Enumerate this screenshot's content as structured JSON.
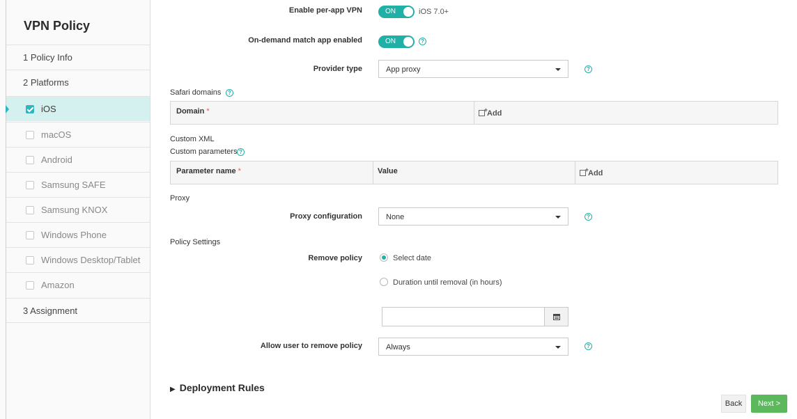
{
  "sidebar": {
    "title": "VPN Policy",
    "steps": [
      {
        "label": "1  Policy Info"
      },
      {
        "label": "2  Platforms"
      }
    ],
    "platforms": [
      {
        "label": "iOS",
        "checked": true
      },
      {
        "label": "macOS",
        "checked": false
      },
      {
        "label": "Android",
        "checked": false
      },
      {
        "label": "Samsung SAFE",
        "checked": false
      },
      {
        "label": "Samsung KNOX",
        "checked": false
      },
      {
        "label": "Windows Phone",
        "checked": false
      },
      {
        "label": "Windows Desktop/Tablet",
        "checked": false
      },
      {
        "label": "Amazon",
        "checked": false
      }
    ],
    "assignment": {
      "label": "3  Assignment"
    }
  },
  "form": {
    "per_app_vpn": {
      "label": "Enable per-app VPN",
      "toggle": "ON",
      "note": "iOS 7.0+"
    },
    "on_demand": {
      "label": "On-demand match app enabled",
      "toggle": "ON"
    },
    "provider_type": {
      "label": "Provider type",
      "value": "App proxy"
    },
    "safari_domains": {
      "label": "Safari domains",
      "col_domain": "Domain",
      "required_mark": "*",
      "add": "Add"
    },
    "custom_xml": {
      "label": "Custom XML"
    },
    "custom_params": {
      "label": "Custom parameters",
      "col_name": "Parameter name",
      "required_mark": "*",
      "col_value": "Value",
      "add": "Add"
    },
    "proxy": {
      "section": "Proxy",
      "label": "Proxy configuration",
      "value": "None"
    },
    "policy_settings": {
      "section": "Policy Settings",
      "remove_label": "Remove policy",
      "opt_select_date": "Select date",
      "opt_duration": "Duration until removal (in hours)",
      "date_value": "",
      "allow_label": "Allow user to remove policy",
      "allow_value": "Always"
    },
    "deployment": {
      "label": "Deployment Rules"
    }
  },
  "footer": {
    "back": "Back",
    "next": "Next >"
  },
  "colors": {
    "accent": "#21b0a5",
    "next_button": "#5cb85c",
    "active_bg": "#d4f1f0"
  }
}
